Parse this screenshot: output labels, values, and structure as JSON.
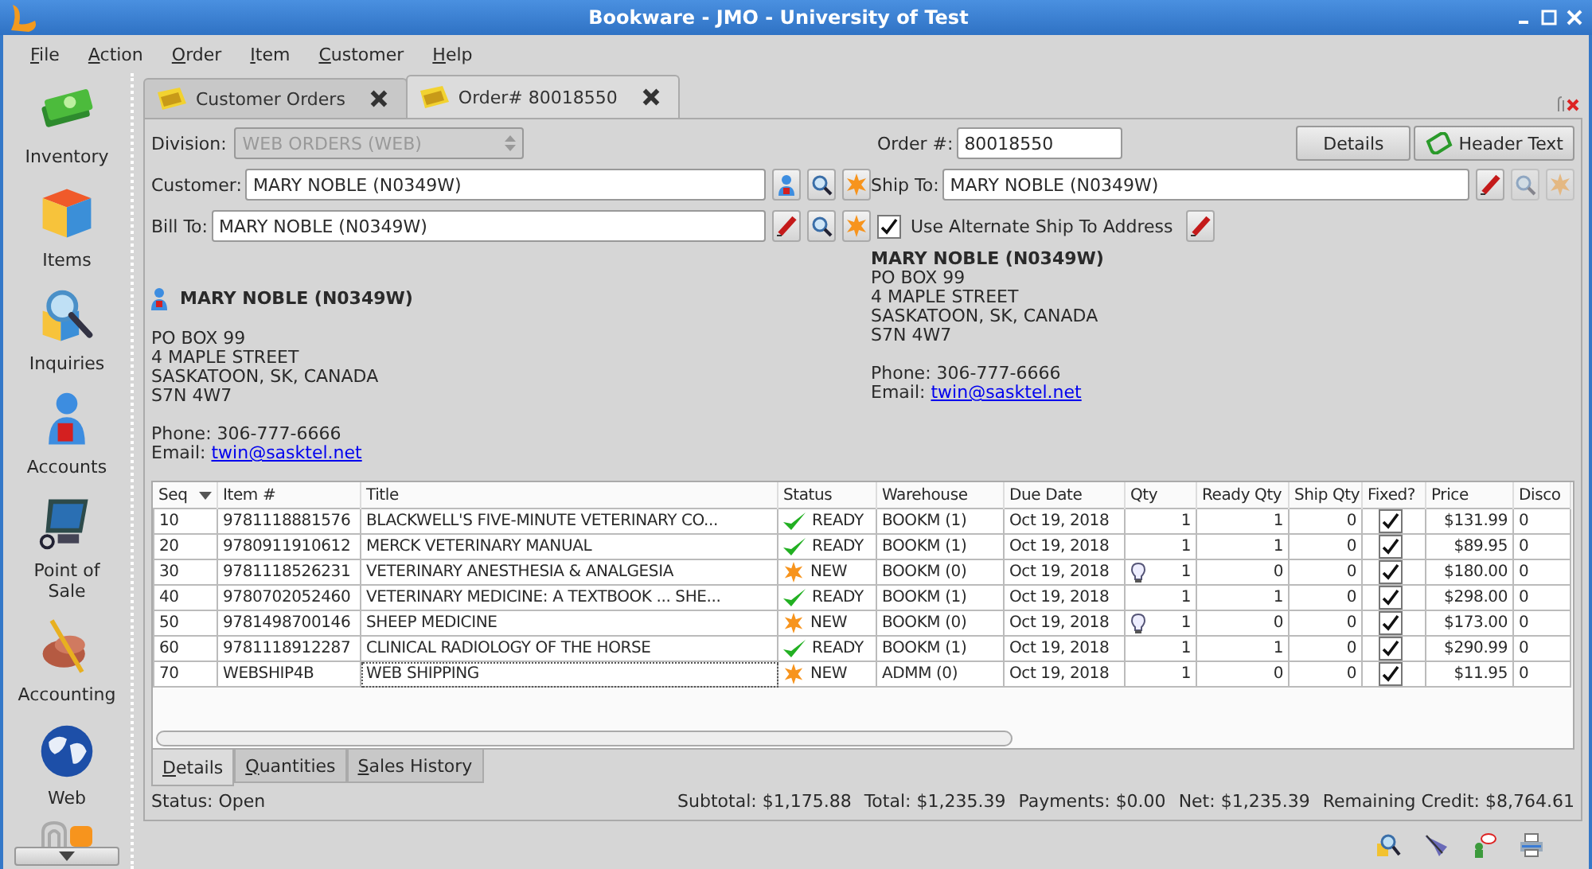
{
  "window": {
    "title": "Bookware - JMO - University of Test"
  },
  "menu": [
    {
      "label": "File"
    },
    {
      "label": "Action"
    },
    {
      "label": "Order"
    },
    {
      "label": "Item"
    },
    {
      "label": "Customer"
    },
    {
      "label": "Help"
    }
  ],
  "sidebar": {
    "items": [
      {
        "label": "Inventory"
      },
      {
        "label": "Items"
      },
      {
        "label": "Inquiries"
      },
      {
        "label": "Accounts"
      },
      {
        "label": "Point of Sale"
      },
      {
        "label": "Accounting"
      },
      {
        "label": "Web"
      }
    ]
  },
  "tabs": [
    {
      "label": "Customer Orders",
      "selected": false
    },
    {
      "label": "Order# 80018550",
      "selected": true
    }
  ],
  "form": {
    "division": {
      "label": "Division:",
      "value": "WEB ORDERS (WEB)",
      "disabled": true
    },
    "customer": {
      "label": "Customer:",
      "value": "MARY NOBLE (N0349W)",
      "buttons": [
        {
          "kind": "person",
          "disabled": false
        },
        {
          "kind": "search",
          "disabled": false
        },
        {
          "kind": "new",
          "disabled": false
        }
      ]
    },
    "bill_to": {
      "label": "Bill To:",
      "value": "MARY NOBLE (N0349W)",
      "buttons": [
        {
          "kind": "edit",
          "disabled": false
        },
        {
          "kind": "search",
          "disabled": false
        },
        {
          "kind": "new",
          "disabled": false
        }
      ]
    },
    "order_no": {
      "label": "Order #:",
      "value": "80018550"
    },
    "buttons": [
      {
        "kind": "plain",
        "label": "Details"
      },
      {
        "kind": "note",
        "label": "Header Text"
      }
    ],
    "ship_to": {
      "label": "Ship To:",
      "value": "MARY NOBLE (N0349W)",
      "buttons": [
        {
          "kind": "edit",
          "disabled": false
        },
        {
          "kind": "search",
          "disabled": true
        },
        {
          "kind": "new",
          "disabled": true
        }
      ]
    },
    "alternate": {
      "label": "Use Alternate Ship To Address",
      "checked": true
    },
    "bill_address": {
      "name": "MARY NOBLE (N0349W)",
      "lines": [
        "PO BOX 99",
        "4 MAPLE STREET",
        "SASKATOON, SK, CANADA",
        "S7N 4W7"
      ],
      "phone": "Phone: 306-777-6666",
      "email_label": "Email:",
      "email": "twin@sasktel.net"
    },
    "ship_address": {
      "name": "MARY NOBLE (N0349W)",
      "lines": [
        "PO BOX 99",
        "4 MAPLE STREET",
        "SASKATOON, SK, CANADA",
        "S7N 4W7"
      ],
      "phone": "Phone: 306-777-6666",
      "email_label": "Email:",
      "email": "twin@sasktel.net"
    }
  },
  "table": {
    "columns": [
      "Seq",
      "Item #",
      "Title",
      "Status",
      "Warehouse",
      "Due Date",
      "Qty",
      "Ready Qty",
      "Ship Qty",
      "Fixed?",
      "Price",
      "Disco"
    ],
    "rows": [
      {
        "seq": "10",
        "item": "9781118881576",
        "title": "BLACKWELL'S FIVE-MINUTE VETERINARY CO...",
        "status": {
          "kind": "ready",
          "label": "READY"
        },
        "warehouse": "BOOKM (1)",
        "due_date": "Oct 19, 2018",
        "qty_hint": false,
        "qty": "1",
        "ready_qty": "1",
        "ship_qty": "0",
        "fixed": true,
        "price": "$131.99",
        "column_12": "0",
        "focused": false
      },
      {
        "seq": "20",
        "item": "9780911910612",
        "title": "MERCK VETERINARY MANUAL",
        "status": {
          "kind": "ready",
          "label": "READY"
        },
        "warehouse": "BOOKM (1)",
        "due_date": "Oct 19, 2018",
        "qty_hint": false,
        "qty": "1",
        "ready_qty": "1",
        "ship_qty": "0",
        "fixed": true,
        "price": "$89.95",
        "column_12": "0",
        "focused": false
      },
      {
        "seq": "30",
        "item": "9781118526231",
        "title": "VETERINARY ANESTHESIA & ANALGESIA",
        "status": {
          "kind": "new",
          "label": "NEW"
        },
        "warehouse": "BOOKM (0)",
        "due_date": "Oct 19, 2018",
        "qty_hint": true,
        "qty": "1",
        "ready_qty": "0",
        "ship_qty": "0",
        "fixed": true,
        "price": "$180.00",
        "column_12": "0",
        "focused": false
      },
      {
        "seq": "40",
        "item": "9780702052460",
        "title": "VETERINARY MEDICINE: A TEXTBOOK ... SHE...",
        "status": {
          "kind": "ready",
          "label": "READY"
        },
        "warehouse": "BOOKM (1)",
        "due_date": "Oct 19, 2018",
        "qty_hint": false,
        "qty": "1",
        "ready_qty": "1",
        "ship_qty": "0",
        "fixed": true,
        "price": "$298.00",
        "column_12": "0",
        "focused": false
      },
      {
        "seq": "50",
        "item": "9781498700146",
        "title": "SHEEP MEDICINE",
        "status": {
          "kind": "new",
          "label": "NEW"
        },
        "warehouse": "BOOKM (0)",
        "due_date": "Oct 19, 2018",
        "qty_hint": true,
        "qty": "1",
        "ready_qty": "0",
        "ship_qty": "0",
        "fixed": true,
        "price": "$173.00",
        "column_12": "0",
        "focused": false
      },
      {
        "seq": "60",
        "item": "9781118912287",
        "title": "CLINICAL RADIOLOGY OF THE HORSE",
        "status": {
          "kind": "ready",
          "label": "READY"
        },
        "warehouse": "BOOKM (1)",
        "due_date": "Oct 19, 2018",
        "qty_hint": false,
        "qty": "1",
        "ready_qty": "1",
        "ship_qty": "0",
        "fixed": true,
        "price": "$290.99",
        "column_12": "0",
        "focused": false
      },
      {
        "seq": "70",
        "item": "WEBSHIP4B",
        "title": "WEB SHIPPING",
        "status": {
          "kind": "new",
          "label": "NEW"
        },
        "warehouse": "ADMM (0)",
        "due_date": "Oct 19, 2018",
        "qty_hint": false,
        "qty": "1",
        "ready_qty": "0",
        "ship_qty": "0",
        "fixed": true,
        "price": "$11.95",
        "column_12": "0",
        "focused": true
      }
    ]
  },
  "bottom_tabs": [
    {
      "label": "Details",
      "selected": true
    },
    {
      "label": "Quantities",
      "selected": false
    },
    {
      "label": "Sales History",
      "selected": false
    }
  ],
  "status_bar": {
    "label": "Status:",
    "value": "Open",
    "totals": [
      {
        "label": "Subtotal:",
        "value": "$1,175.88"
      },
      {
        "label": "Total:",
        "value": "$1,235.39"
      },
      {
        "label": "Payments:",
        "value": "$0.00"
      },
      {
        "label": "Net:",
        "value": "$1,235.39"
      },
      {
        "label": "Remaining Credit:",
        "value": "$8,764.61"
      }
    ]
  }
}
